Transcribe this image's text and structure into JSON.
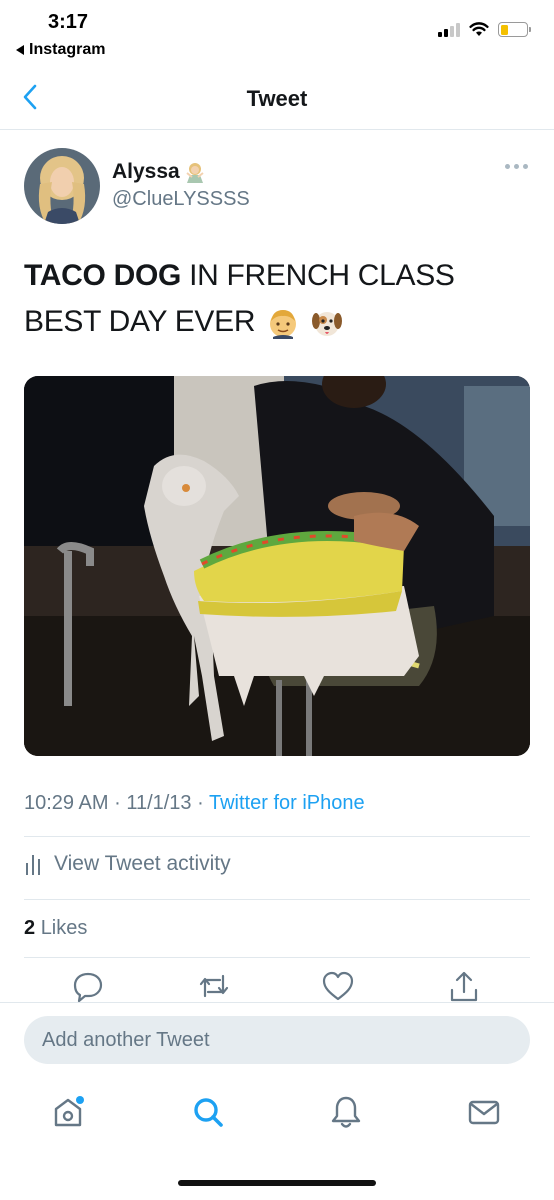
{
  "status_bar": {
    "time": "3:17",
    "back_app": "Instagram",
    "battery_level": 0.3
  },
  "nav": {
    "title": "Tweet",
    "back_icon": "chevron-left-icon"
  },
  "author": {
    "name": "Alyssa",
    "name_emoji": "woman-gesturing-icon",
    "handle": "@ClueLYSSSS"
  },
  "tweet": {
    "text_bold": "TACO DOG",
    "text_rest": " IN FRENCH CLASS",
    "text_line2": "BEST DAY EVER",
    "emojis": [
      "man-face-emoji",
      "dog-face-emoji"
    ],
    "media_alt": "photo"
  },
  "meta": {
    "time": "10:29 AM",
    "date": "11/1/13",
    "separator": "·",
    "source": "Twitter for iPhone"
  },
  "activity": {
    "label": "View Tweet activity",
    "icon": "bar-chart-icon"
  },
  "likes": {
    "count": "2",
    "label": "Likes"
  },
  "actions": [
    "reply-icon",
    "retweet-icon",
    "like-icon",
    "share-icon"
  ],
  "composer": {
    "placeholder": "Add another Tweet"
  },
  "tabs": [
    "home-icon",
    "search-icon",
    "notifications-icon",
    "messages-icon"
  ],
  "colors": {
    "accent": "#1da1f2",
    "secondary_text": "#657786",
    "divider": "#e1e8ed",
    "composer_bg": "#e6ecf0"
  }
}
